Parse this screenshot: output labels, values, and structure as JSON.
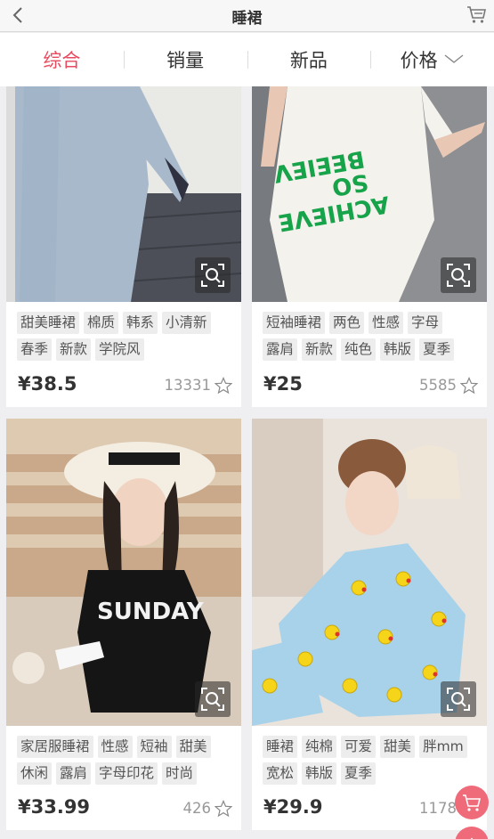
{
  "header": {
    "title": "睡裙",
    "back_icon": "chevron-left-icon",
    "cart_icon": "cart-icon"
  },
  "sort": {
    "items": [
      {
        "label": "综合",
        "active": true
      },
      {
        "label": "销量",
        "active": false
      },
      {
        "label": "新品",
        "active": false
      },
      {
        "label": "价格",
        "active": false
      }
    ]
  },
  "products": [
    {
      "tags": [
        "甜美睡裙",
        "棉质",
        "韩系",
        "小清新",
        "春季",
        "新款",
        "学院风"
      ],
      "price": "¥38.5",
      "sales": "13331"
    },
    {
      "tags": [
        "短袖睡裙",
        "两色",
        "性感",
        "字母",
        "露肩",
        "新款",
        "纯色",
        "韩版",
        "夏季"
      ],
      "price": "¥25",
      "sales": "5585"
    },
    {
      "tags": [
        "家居服睡裙",
        "性感",
        "短袖",
        "甜美",
        "休闲",
        "露肩",
        "字母印花",
        "时尚"
      ],
      "price": "¥33.99",
      "sales": "426"
    },
    {
      "tags": [
        "睡裙",
        "纯棉",
        "可爱",
        "甜美",
        "胖mm",
        "宽松",
        "韩版",
        "夏季"
      ],
      "price": "¥29.9",
      "sales": "1178"
    }
  ],
  "photo_text": {
    "p1": "BELIEVE SO ACHIEVE",
    "p2": "SUNDAY"
  },
  "colors": {
    "accent": "#e84a5f",
    "float_button": "#f06b7a"
  }
}
